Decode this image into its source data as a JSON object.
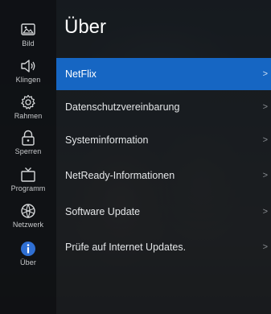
{
  "page": {
    "title": "Über"
  },
  "sidebar": {
    "items": [
      {
        "label": "Bild",
        "icon": "picture-icon"
      },
      {
        "label": "Klingen",
        "icon": "speaker-icon"
      },
      {
        "label": "Rahmen",
        "icon": "gear-icon"
      },
      {
        "label": "Sperren",
        "icon": "lock-icon"
      },
      {
        "label": "Programm",
        "icon": "tv-icon"
      },
      {
        "label": "Netzwerk",
        "icon": "globe-icon"
      },
      {
        "label": "Über",
        "icon": "info-icon",
        "selected": true
      }
    ]
  },
  "menu": {
    "items": [
      {
        "label": "NetFlix",
        "active": true
      },
      {
        "label": "Datenschutzvereinbarung"
      },
      {
        "label": "Systeminformation"
      },
      {
        "label": "NetReady-Informationen"
      },
      {
        "label": "Software Update"
      },
      {
        "label": "Prüfe auf Internet Updates."
      }
    ],
    "chevron": ">"
  },
  "colors": {
    "accent": "#1666c3",
    "info_icon": "#2f6fd3"
  }
}
